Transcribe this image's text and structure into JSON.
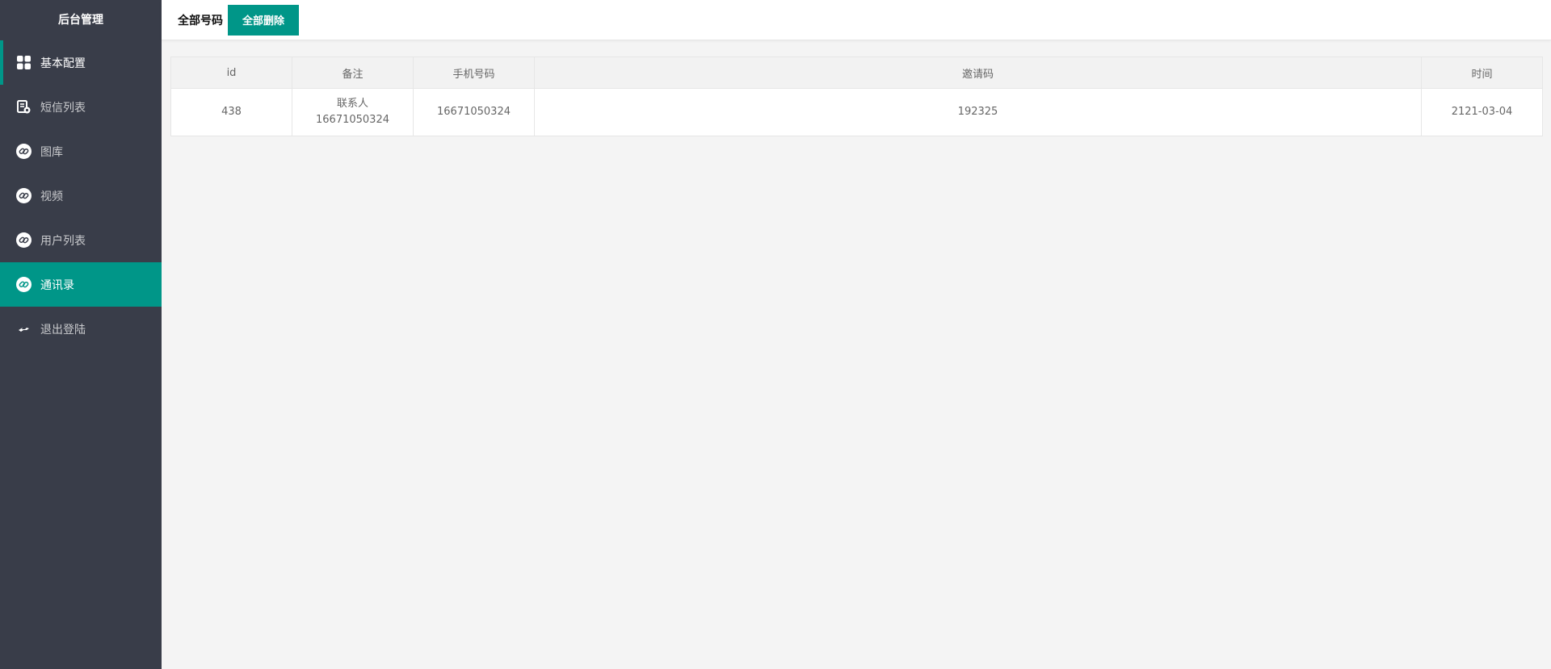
{
  "sidebar": {
    "title": "后台管理",
    "items": [
      {
        "label": "基本配置",
        "icon": "grid-icon"
      },
      {
        "label": "短信列表",
        "icon": "message-list-icon"
      },
      {
        "label": "图库",
        "icon": "link-icon"
      },
      {
        "label": "视频",
        "icon": "link-icon"
      },
      {
        "label": "用户列表",
        "icon": "link-icon"
      },
      {
        "label": "通讯录",
        "icon": "link-icon"
      },
      {
        "label": "退出登陆",
        "icon": "logout-icon"
      }
    ],
    "active_index": 5
  },
  "header": {
    "title": "全部号码",
    "delete_all_label": "全部删除"
  },
  "table": {
    "columns": [
      "id",
      "备注",
      "手机号码",
      "邀请码",
      "时间"
    ],
    "rows": [
      {
        "id": "438",
        "remark_line1": "联系人",
        "remark_line2": "16671050324",
        "phone": "16671050324",
        "invite_code": "192325",
        "time": "2121-03-04"
      }
    ]
  },
  "colors": {
    "sidebar_bg": "#393d49",
    "accent": "#009688",
    "page_bg": "#f4f4f4"
  }
}
